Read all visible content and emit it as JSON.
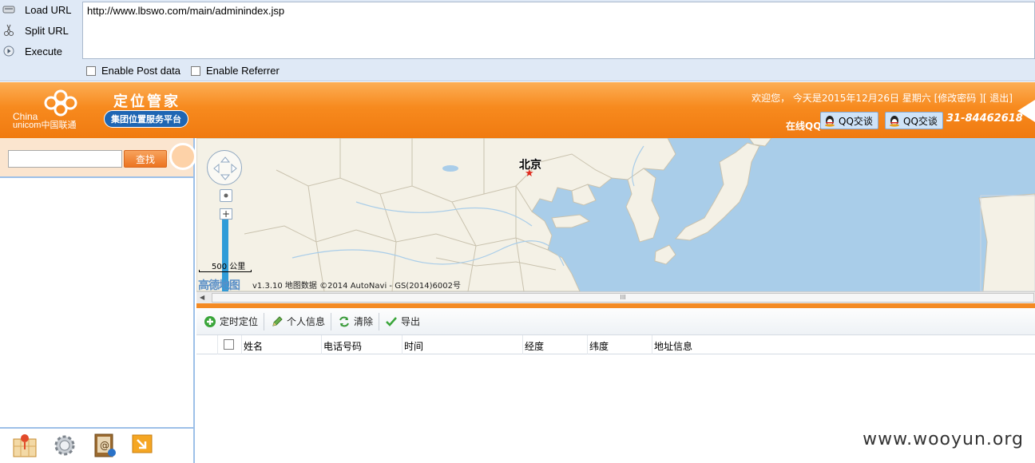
{
  "hackbar": {
    "load_url_label": "Load URL",
    "split_url_label": "Split URL",
    "execute_label": "Execute",
    "url_value": "http://www.lbswo.com/main/adminindex.jsp",
    "enable_post_label": "Enable Post data",
    "enable_referrer_label": "Enable Referrer"
  },
  "header": {
    "logo_text_1": "China",
    "logo_text_2": "unicom中国联通",
    "app_title": "定位管家",
    "app_subtitle": "集团位置服务平台",
    "welcome_text": "欢迎您，  今天是2015年12月26日 星期六",
    "change_password": "[修改密码 ]",
    "logout": "[ 退出]",
    "online_qq_label": "在线QQ",
    "qq_button_1": "QQ交谈",
    "qq_button_2": "QQ交谈",
    "phone": "31-84462618"
  },
  "search": {
    "input_value": "",
    "button_label": "查找"
  },
  "map": {
    "city_label": "北京",
    "zoom_plus": "+",
    "scale_label": "500 公里",
    "provider_logo": "高德地图",
    "copyright": "v1.3.10 地图数据 ©2014 AutoNavi - GS(2014)6002号"
  },
  "scrollbar": {
    "grip": "III"
  },
  "toolbar": {
    "timed_locate": "定时定位",
    "personal_info": "个人信息",
    "clear": "清除",
    "export": "导出"
  },
  "grid": {
    "columns": [
      "姓名",
      "电话号码",
      "时间",
      "经度",
      "纬度",
      "地址信息"
    ]
  },
  "watermark": "www.wooyun.org",
  "colors": {
    "header_orange": "#f78a1e",
    "panel_border_blue": "#9dc0e8",
    "sea_blue": "#a9cde9",
    "land": "#f4f1e6"
  }
}
